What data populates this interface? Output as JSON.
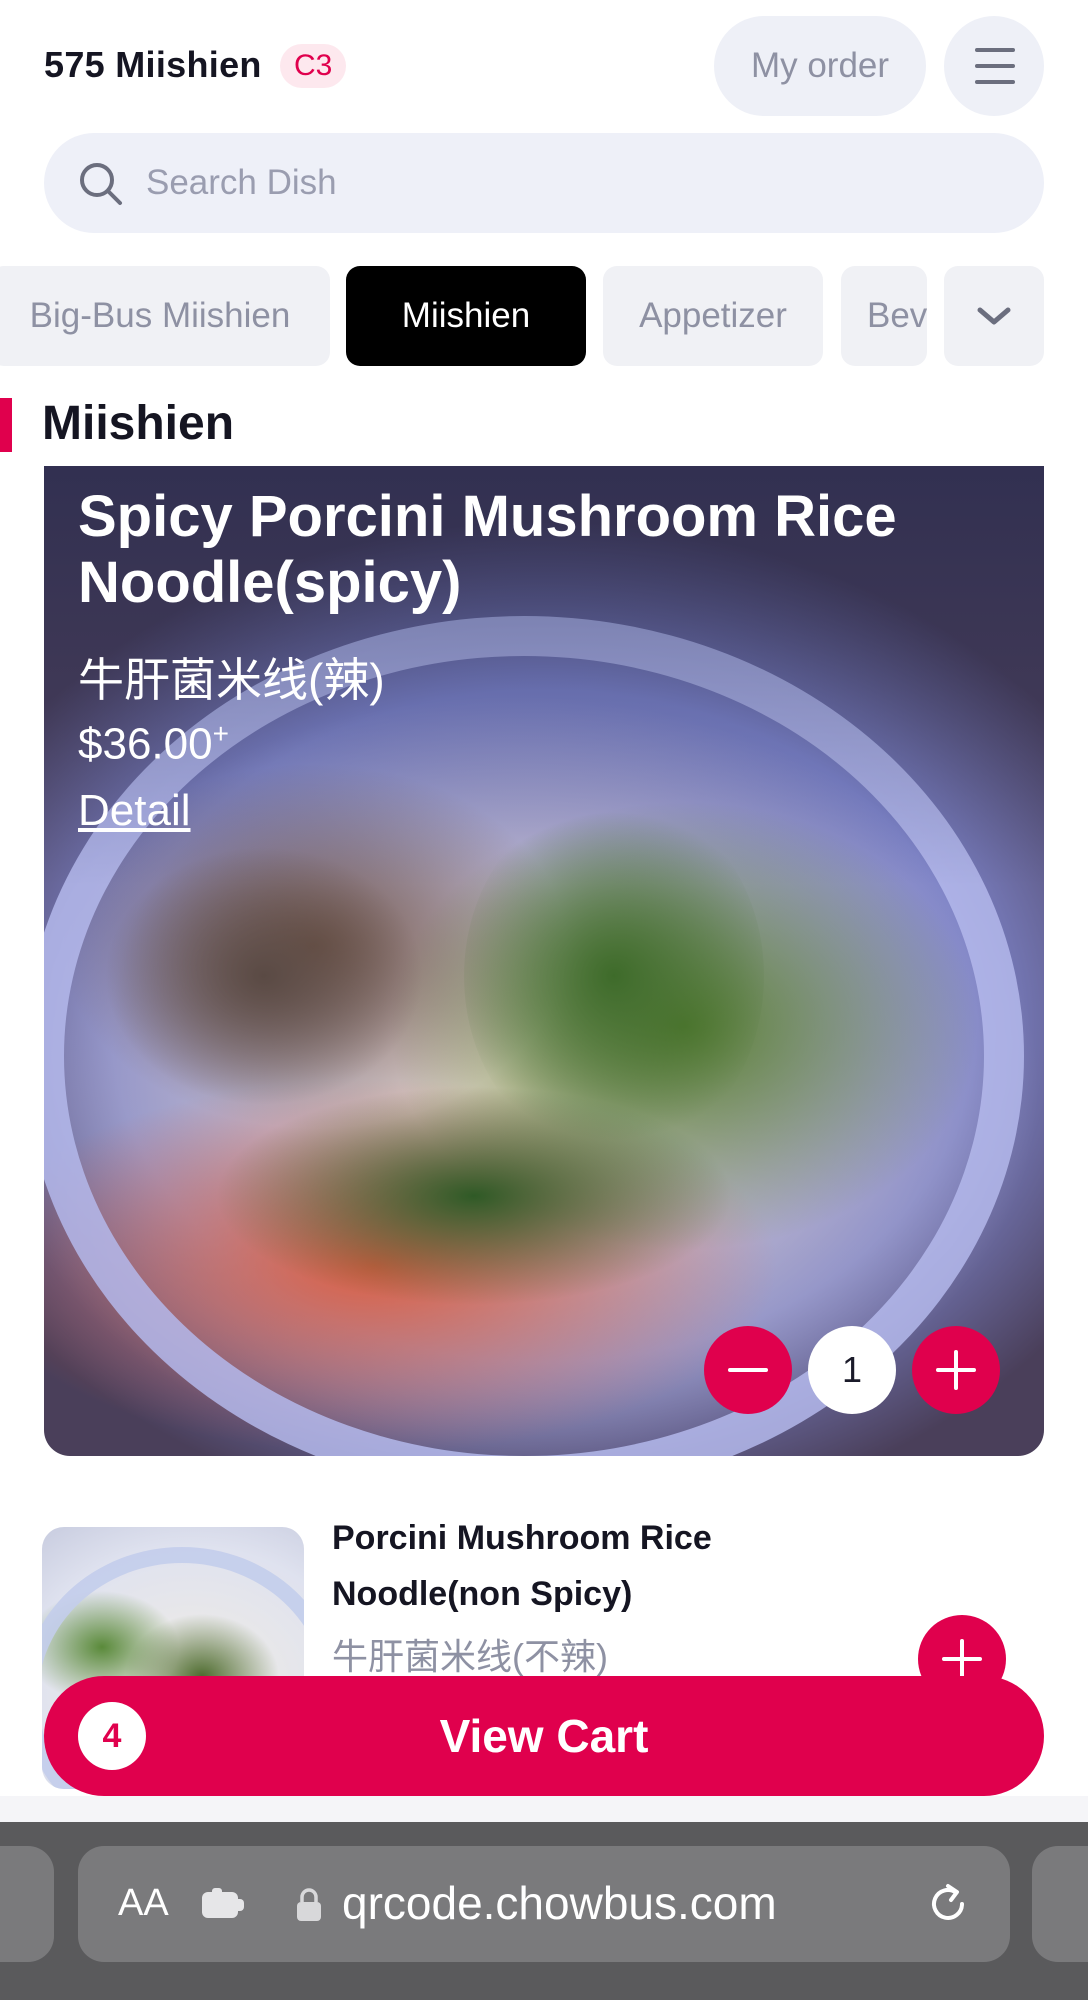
{
  "header": {
    "store_name": "575 Miishien",
    "table_badge": "C3",
    "my_order_label": "My order"
  },
  "search": {
    "placeholder": "Search Dish"
  },
  "categories": {
    "tabs": [
      {
        "label": "Big-Bus Miishien",
        "active": false
      },
      {
        "label": "Miishien",
        "active": true
      },
      {
        "label": "Appetizer",
        "active": false
      },
      {
        "label": "Bev",
        "active": false
      }
    ]
  },
  "section": {
    "title": "Miishien"
  },
  "featured_item": {
    "name": "Spicy Porcini Mushroom Rice Noodle(spicy)",
    "name_cn": "牛肝菌米线(辣)",
    "price": "$36.00",
    "price_suffix": "+",
    "detail_label": "Detail",
    "quantity": "1"
  },
  "item2": {
    "name": "Porcini Mushroom Rice Noodle(non Spicy)",
    "name_cn": "牛肝菌米线(不辣)"
  },
  "cart": {
    "count": "4",
    "label": "View Cart"
  },
  "browser": {
    "text_size_label": "AA",
    "url": "qrcode.chowbus.com"
  },
  "colors": {
    "accent": "#e0004d",
    "active_tab": "#000000",
    "chip_bg": "#eef0f7"
  }
}
